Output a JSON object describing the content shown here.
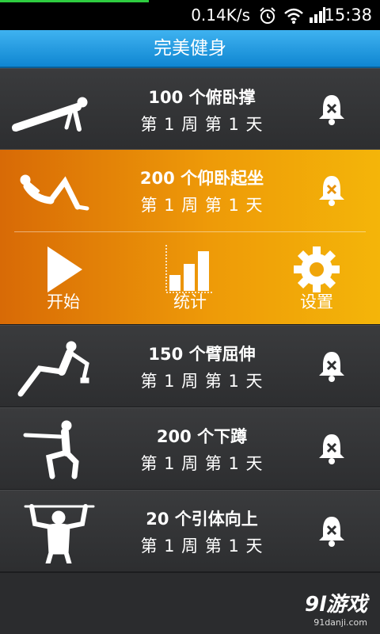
{
  "status_bar": {
    "network_speed": "0.14K/s",
    "time": "15:38"
  },
  "app": {
    "title": "完美健身"
  },
  "exercises": [
    {
      "name": "100 个俯卧撑",
      "progress": "第 1 周 第 1 天"
    },
    {
      "name": "200 个仰卧起坐",
      "progress": "第 1 周 第 1 天"
    },
    {
      "name": "150 个臂屈伸",
      "progress": "第 1 周 第 1 天"
    },
    {
      "name": "200 个下蹲",
      "progress": "第 1 周 第 1 天"
    },
    {
      "name": "20 个引体向上",
      "progress": "第 1 周 第 1 天"
    }
  ],
  "actions": {
    "start": "开始",
    "stats": "统计",
    "settings": "设置"
  },
  "watermark": {
    "main": "9l游戏",
    "url": "91danji.com"
  },
  "colors": {
    "title_bar": "#1d97dd",
    "active_row": "#ee9a08",
    "row_bg": "#333436"
  }
}
